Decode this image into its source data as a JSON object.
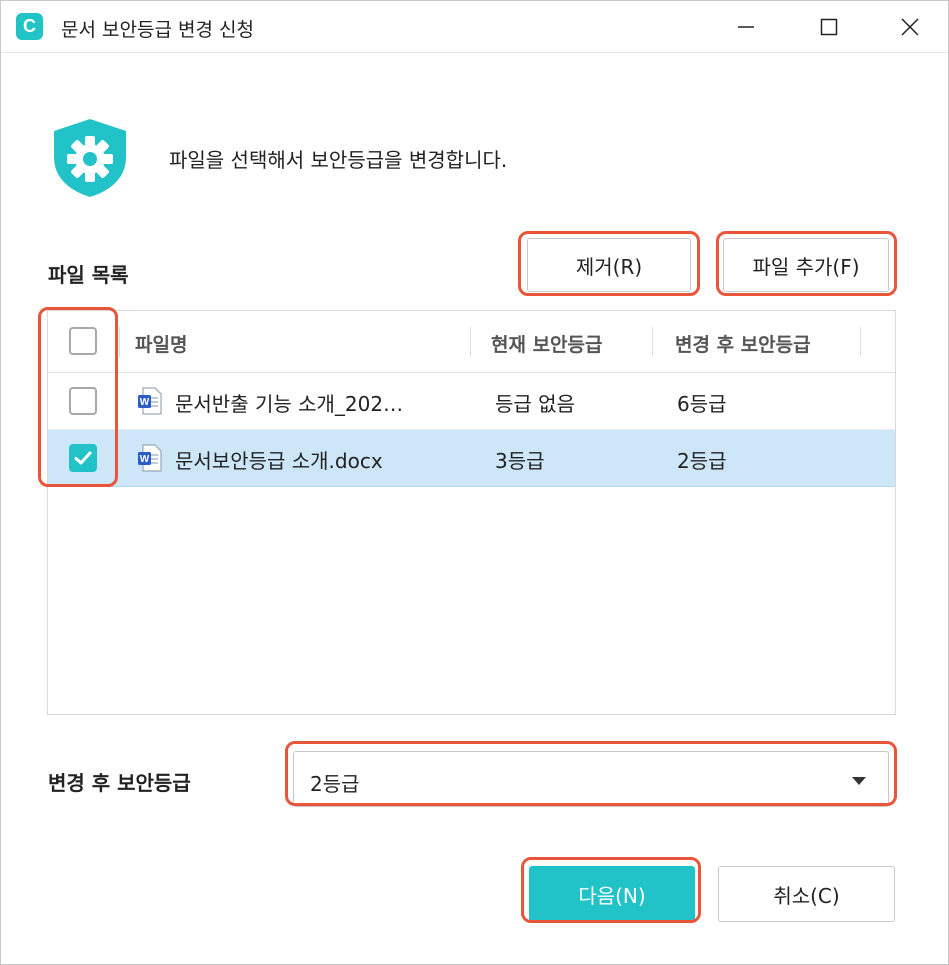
{
  "window": {
    "title": "문서 보안등급 변경 신청",
    "logo_letter": "C",
    "controls": [
      "minimize-icon",
      "maximize-icon",
      "close-icon"
    ]
  },
  "header": {
    "icon": "shield-gear-icon",
    "description": "파일을 선택해서 보안등급을 변경합니다."
  },
  "file_list": {
    "label": "파일 목록",
    "remove_button": "제거(R)",
    "add_button": "파일 추가(F)",
    "columns": [
      "파일명",
      "현재 보안등급",
      "변경 후 보안등급"
    ],
    "header_checkbox_checked": false,
    "rows": [
      {
        "checked": false,
        "selected": false,
        "file_icon": "word-file-icon",
        "name": "문서반출 기능 소개_202…",
        "current_grade": "등급 없음",
        "new_grade": "6등급"
      },
      {
        "checked": true,
        "selected": true,
        "file_icon": "word-file-icon",
        "name": "문서보안등급 소개.docx",
        "current_grade": "3등급",
        "new_grade": "2등급"
      }
    ]
  },
  "grade_select": {
    "label": "변경 후 보안등급",
    "value": "2등급"
  },
  "footer": {
    "next_button": "다음(N)",
    "cancel_button": "취소(C)"
  },
  "colors": {
    "accent": "#22c3c8",
    "selected_row": "#cde7f8",
    "highlight": "#e8553a"
  }
}
